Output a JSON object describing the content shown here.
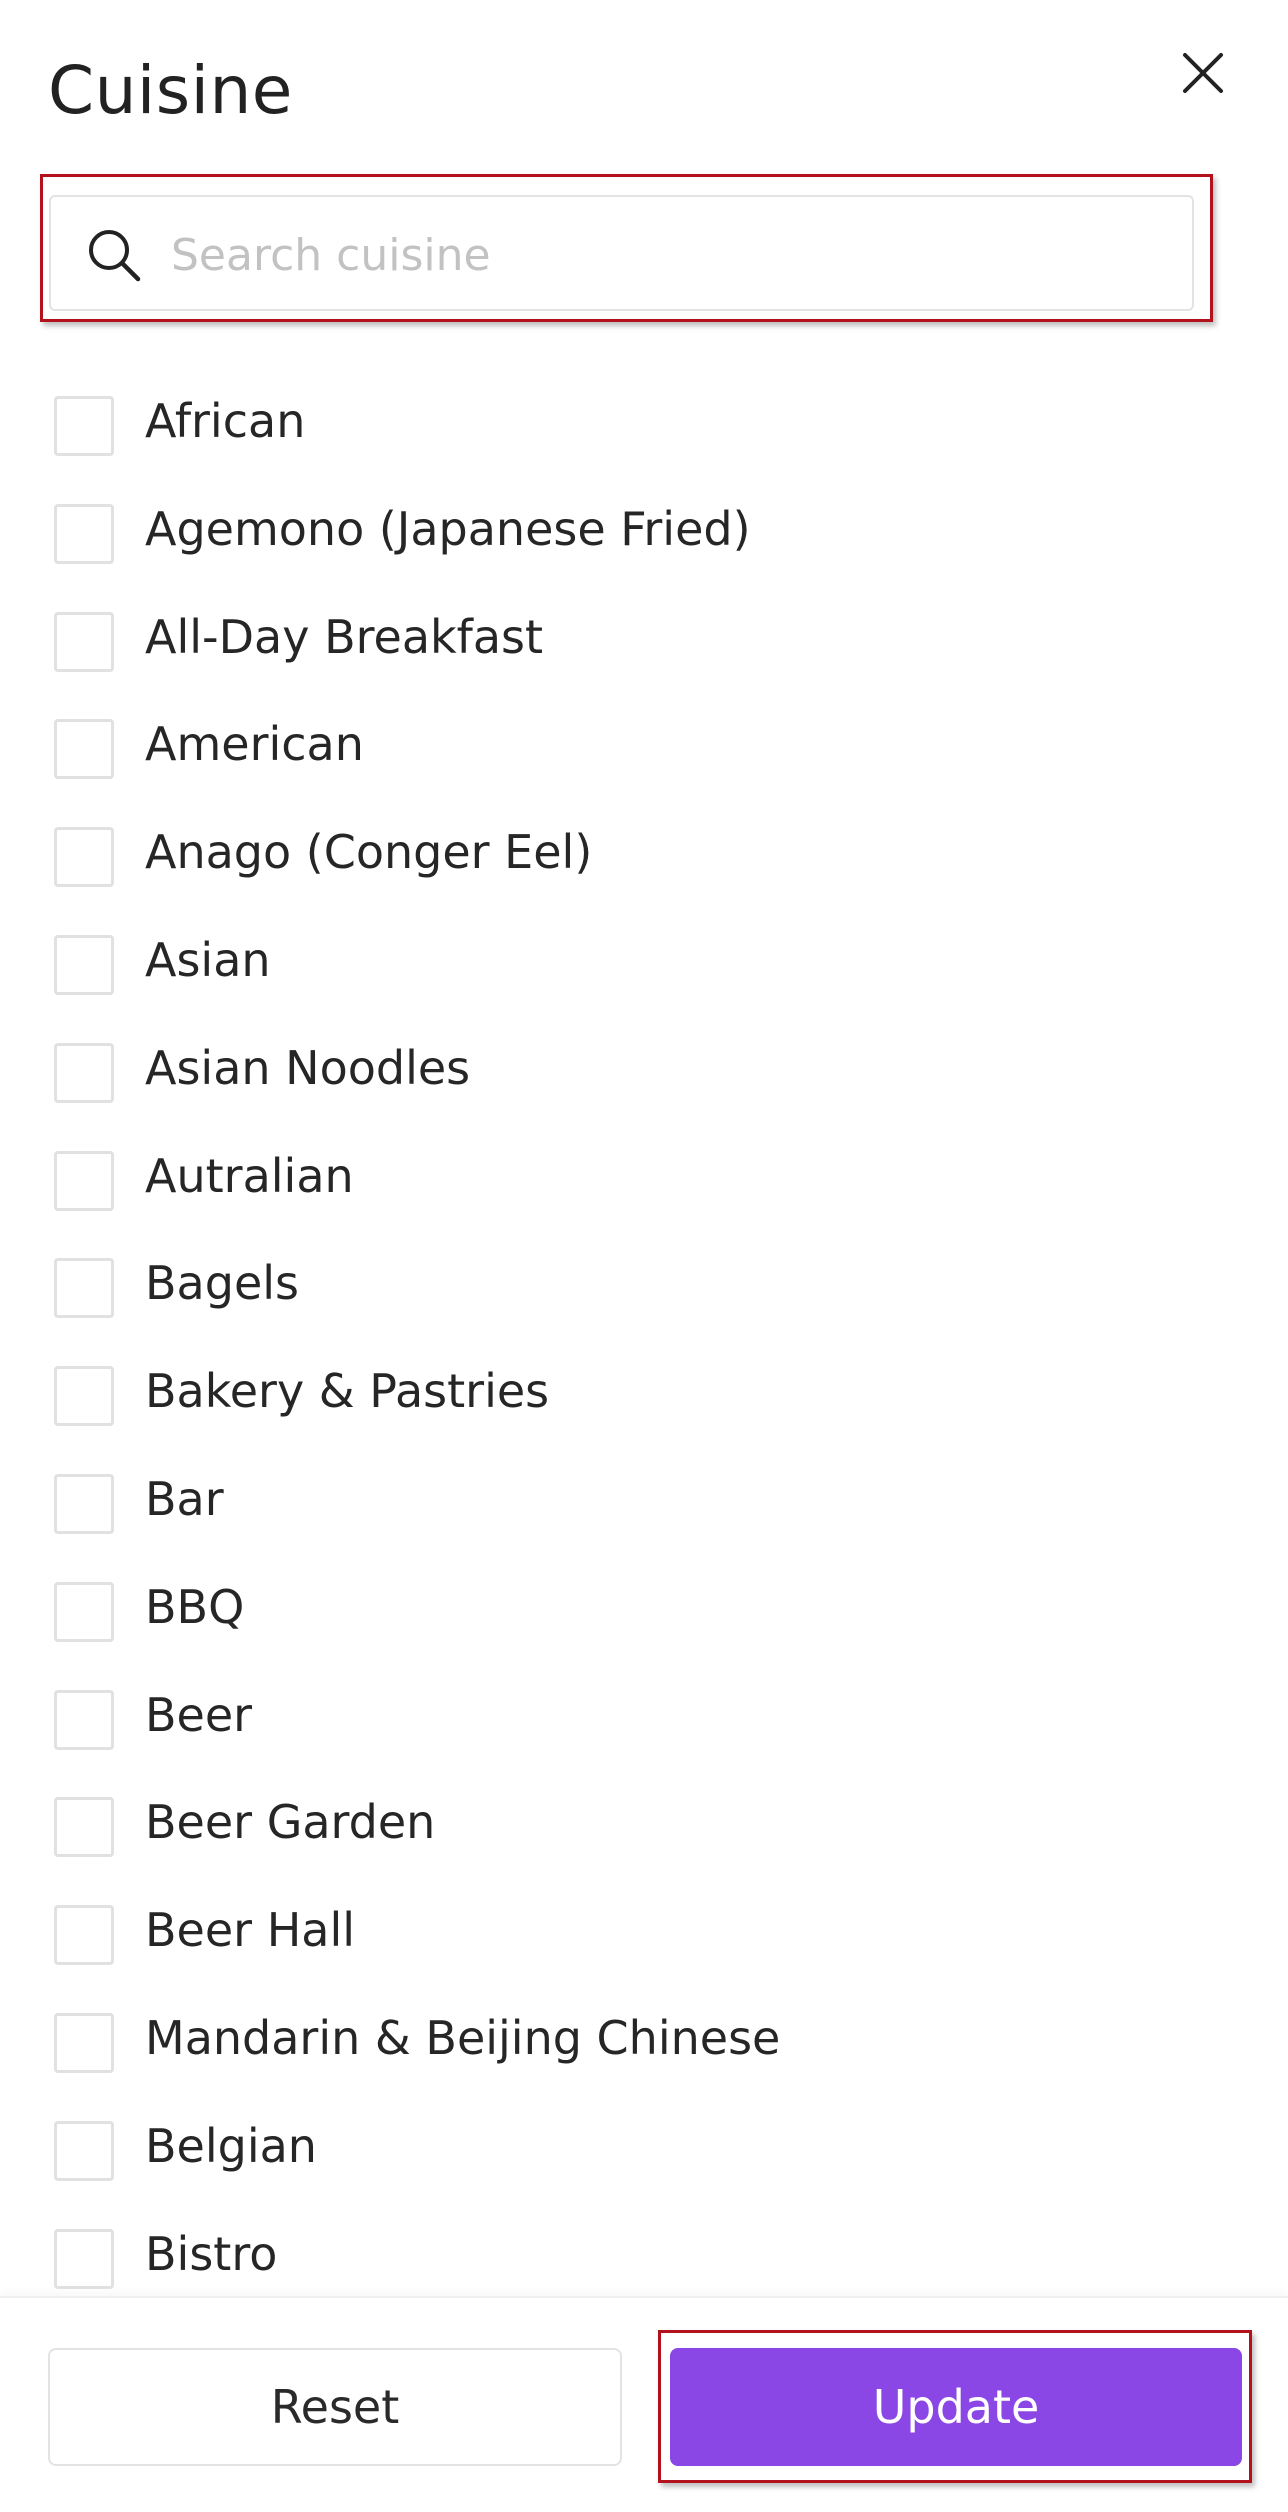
{
  "header": {
    "title": "Cuisine",
    "close_icon": "close-icon"
  },
  "search": {
    "placeholder": "Search cuisine",
    "value": "",
    "icon": "search-icon"
  },
  "cuisines": [
    {
      "label": "African",
      "checked": false
    },
    {
      "label": "Agemono (Japanese Fried)",
      "checked": false
    },
    {
      "label": "All-Day Breakfast",
      "checked": false
    },
    {
      "label": "American",
      "checked": false
    },
    {
      "label": "Anago (Conger Eel)",
      "checked": false
    },
    {
      "label": "Asian",
      "checked": false
    },
    {
      "label": "Asian Noodles",
      "checked": false
    },
    {
      "label": "Autralian",
      "checked": false
    },
    {
      "label": "Bagels",
      "checked": false
    },
    {
      "label": "Bakery & Pastries",
      "checked": false
    },
    {
      "label": "Bar",
      "checked": false
    },
    {
      "label": "BBQ",
      "checked": false
    },
    {
      "label": "Beer",
      "checked": false
    },
    {
      "label": "Beer Garden",
      "checked": false
    },
    {
      "label": "Beer Hall",
      "checked": false
    },
    {
      "label": "Mandarin & Beijing Chinese",
      "checked": false
    },
    {
      "label": "Belgian",
      "checked": false
    },
    {
      "label": "Bistro",
      "checked": false
    }
  ],
  "footer": {
    "reset_label": "Reset",
    "update_label": "Update"
  },
  "colors": {
    "accent": "#8a47e6",
    "highlight": "#b3121c",
    "border": "#e3e3e3"
  }
}
